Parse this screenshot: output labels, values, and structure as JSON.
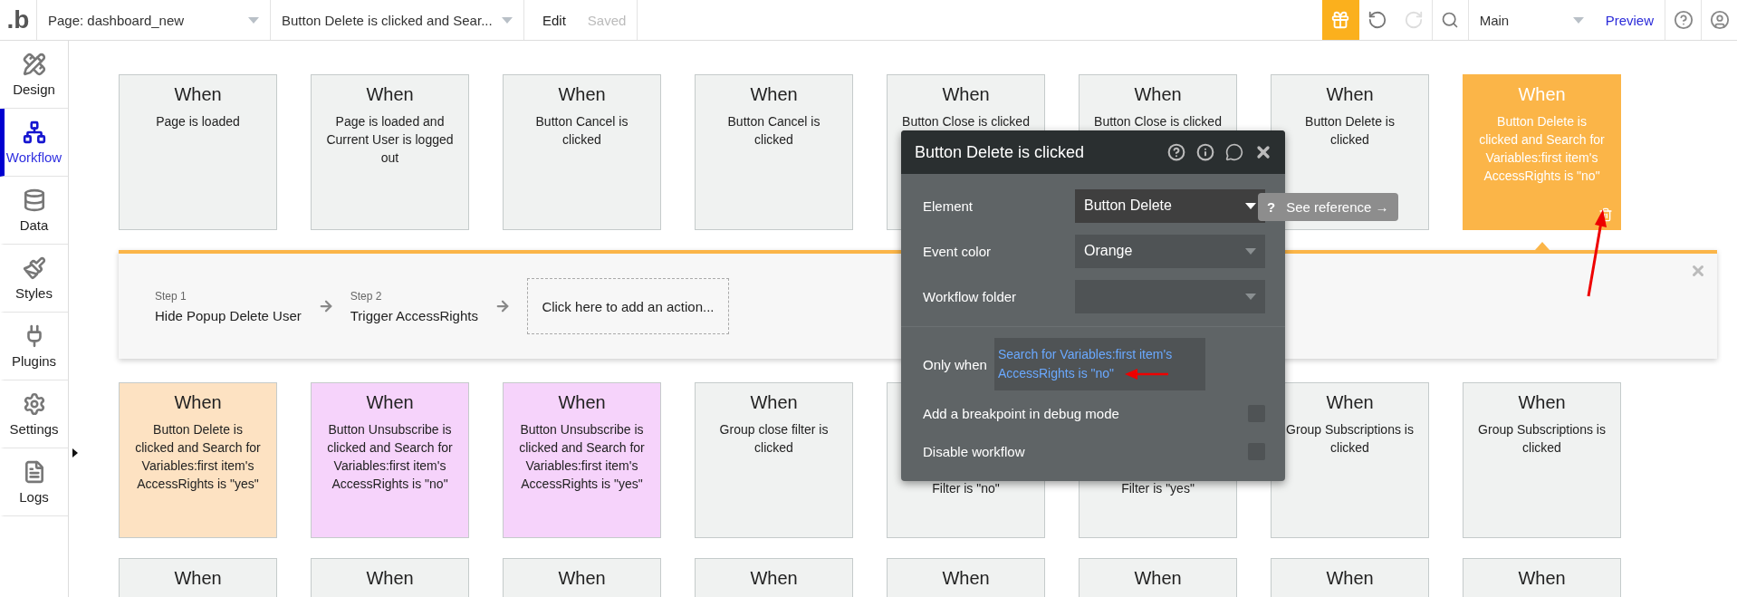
{
  "topbar": {
    "logo": ".b",
    "page_select": "Page: dashboard_new",
    "workflow_select": "Button Delete is clicked and Sear...",
    "edit_label": "Edit",
    "save_status": "Saved",
    "redo_disabled": true,
    "version_select": "Main",
    "preview_link": "Preview"
  },
  "sidebar": {
    "items": [
      {
        "kind": "design",
        "label": "Design",
        "selected": false
      },
      {
        "kind": "workflow",
        "label": "Workflow",
        "selected": true
      },
      {
        "kind": "data",
        "label": "Data",
        "selected": false
      },
      {
        "kind": "styles",
        "label": "Styles",
        "selected": false
      },
      {
        "kind": "plugins",
        "label": "Plugins",
        "selected": false
      },
      {
        "kind": "settings",
        "label": "Settings",
        "selected": false
      },
      {
        "kind": "logs",
        "label": "Logs",
        "selected": false
      }
    ]
  },
  "event_rows": [
    {
      "cards": [
        {
          "title": "When",
          "text": "Page is loaded",
          "color": "#f0f2f1",
          "selected": false
        },
        {
          "title": "When",
          "text": "Page is loaded and Current User is logged out",
          "color": "#f0f2f1",
          "selected": false
        },
        {
          "title": "When",
          "text": "Button Cancel is clicked",
          "color": "#f0f2f1",
          "selected": false
        },
        {
          "title": "When",
          "text": "Button Cancel is clicked",
          "color": "#f0f2f1",
          "selected": false
        },
        {
          "title": "When",
          "text": "Button Close is clicked",
          "color": "#f0f2f1",
          "selected": false
        },
        {
          "title": "When",
          "text": "Button Close is clicked",
          "color": "#f0f2f1",
          "selected": false
        },
        {
          "title": "When",
          "text": "Button Delete is clicked",
          "color": "#f0f2f1",
          "selected": false
        },
        {
          "title": "When",
          "text": "Button Delete is clicked and Search for Variables:first item's AccessRights is \"no\"",
          "color": "#fbb548",
          "selected": true
        }
      ]
    },
    {
      "cards": [
        {
          "title": "When",
          "text": "Button Delete is clicked and Search for Variables:first item's AccessRights is \"yes\"",
          "color": "#fde2c2",
          "selected": false
        },
        {
          "title": "When",
          "text": "Button Unsubscribe is clicked and Search for Variables:first item's AccessRights is \"no\"",
          "color": "#f6d3fb",
          "selected": false
        },
        {
          "title": "When",
          "text": "Button Unsubscribe is clicked and Search for Variables:first item's AccessRights is \"yes\"",
          "color": "#f6d3fb",
          "selected": false
        },
        {
          "title": "When",
          "text": "Group close filter is clicked",
          "color": "#f0f2f1",
          "selected": false
        },
        {
          "text": "Filter is \"no\"",
          "color": "#f0f2f1",
          "selected": false,
          "covered": true
        },
        {
          "text": "Filter is \"yes\"",
          "color": "#f0f2f1",
          "selected": false,
          "covered": true
        },
        {
          "title": "When",
          "text": "Group Subscriptions is clicked",
          "color": "#f0f2f1",
          "selected": false
        },
        {
          "title": "When",
          "text": "Group Subscriptions is clicked",
          "color": "#f0f2f1",
          "selected": false
        }
      ]
    },
    {
      "cards": [
        {
          "title": "When",
          "color": "#f0f2f1",
          "selected": false
        },
        {
          "title": "When",
          "color": "#f0f2f1",
          "selected": false
        },
        {
          "title": "When",
          "color": "#f0f2f1",
          "selected": false
        },
        {
          "title": "When",
          "color": "#f0f2f1",
          "selected": false
        },
        {
          "title": "When",
          "color": "#f0f2f1",
          "selected": false
        },
        {
          "title": "When",
          "color": "#f0f2f1",
          "selected": false
        },
        {
          "title": "When",
          "color": "#f0f2f1",
          "selected": false
        },
        {
          "title": "When",
          "color": "#f0f2f1",
          "selected": false
        }
      ]
    }
  ],
  "workflow_panel": {
    "steps": [
      {
        "step": "Step 1",
        "action": "Hide Popup Delete User"
      },
      {
        "step": "Step 2",
        "action": "Trigger AccessRights"
      }
    ],
    "add_action": "Click here to add an action..."
  },
  "popup": {
    "title": "Button Delete is clicked",
    "fields": [
      {
        "kind": "select",
        "label": "Element",
        "value": "Button Delete",
        "dark": true,
        "reference": "See reference →",
        "reference_mark": "?"
      },
      {
        "kind": "select",
        "label": "Event color",
        "value": "Orange",
        "dark": false
      },
      {
        "kind": "select",
        "label": "Workflow folder",
        "dark": false
      },
      {
        "kind": "condition",
        "label": "Only when",
        "value": "Search for Variables:first item's AccessRights is \"no\""
      },
      {
        "kind": "checkbox",
        "label": "Add a breakpoint in debug mode",
        "checked": false
      },
      {
        "kind": "checkbox",
        "label": "Disable workflow",
        "checked": false
      }
    ]
  }
}
